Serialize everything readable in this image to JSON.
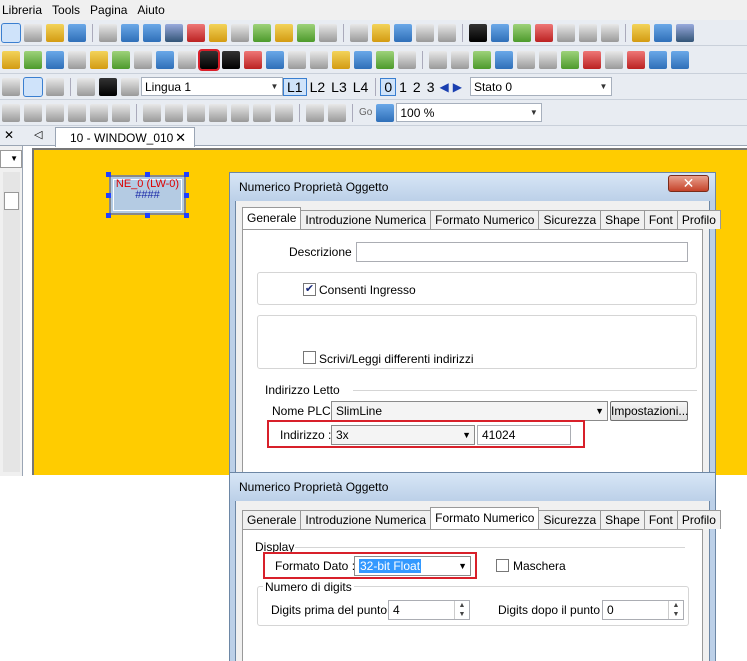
{
  "menu": [
    "Libreria",
    "Tools",
    "Pagina",
    "Aiuto"
  ],
  "toolbar3": {
    "font_label": "Lingua 1",
    "lang_buttons": [
      "L1",
      "L2",
      "L3",
      "L4"
    ],
    "state_buttons": [
      "0",
      "1",
      "2",
      "3"
    ],
    "state_label": "Stato 0"
  },
  "toolbar4": {
    "go_label": "Go",
    "zoom": "100 %"
  },
  "tabstrip": {
    "tab_label": "10 - WINDOW_010"
  },
  "canvas": {
    "object_line1": "NE_0 (LW-0)",
    "object_line2": "####"
  },
  "dialog1": {
    "title": "Numerico Proprietà Oggetto",
    "tabs": [
      "Generale",
      "Introduzione Numerica",
      "Formato Numerico",
      "Sicurezza",
      "Shape",
      "Font",
      "Profilo"
    ],
    "active_tab": "Generale",
    "descrizione_label": "Descrizione :",
    "descrizione_value": "",
    "consenti_label": "Consenti Ingresso",
    "consenti_checked": true,
    "scrivi_label": "Scrivi/Leggi differenti indirizzi",
    "scrivi_checked": false,
    "indirizzo_group": "Indirizzo Letto",
    "plc_label": "Nome PLC :",
    "plc_value": "SlimLine",
    "impostazioni_label": "Impostazioni...",
    "indirizzo_label": "Indirizzo :",
    "indirizzo_type": "3x",
    "indirizzo_value": "41024"
  },
  "dialog2": {
    "title": "Numerico Proprietà Oggetto",
    "tabs": [
      "Generale",
      "Introduzione Numerica",
      "Formato Numerico",
      "Sicurezza",
      "Shape",
      "Font",
      "Profilo"
    ],
    "active_tab": "Formato Numerico",
    "display_group": "Display",
    "formato_label": "Formato Dato :",
    "formato_value": "32-bit Float",
    "maschera_label": "Maschera",
    "maschera_checked": false,
    "digits_group": "Numero di digits",
    "digits_before_label": "Digits prima del punto :",
    "digits_before_value": "4",
    "digits_after_label": "Digits dopo il punto :",
    "digits_after_value": "0"
  }
}
